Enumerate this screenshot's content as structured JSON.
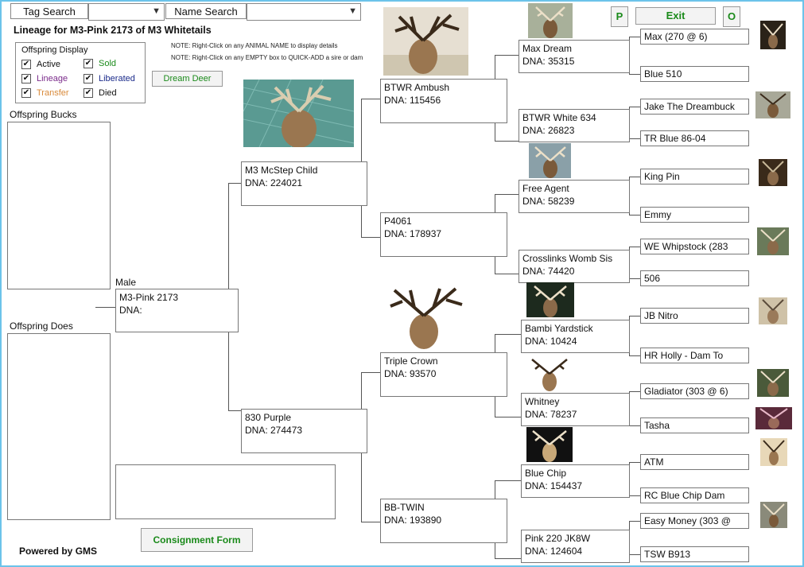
{
  "search": {
    "tag_label": "Tag Search",
    "name_label": "Name Search",
    "tag_value": "",
    "name_value": ""
  },
  "title": "Lineage for M3-Pink 2173 of M3 Whitetails",
  "notes": {
    "right_click_name": "NOTE: Right-Click on any ANIMAL NAME to display details",
    "right_click_empty": "NOTE: Right-Click on any EMPTY box to QUICK-ADD a sire or dam"
  },
  "legend": {
    "title": "Offspring Display",
    "items": [
      {
        "label": "Active",
        "checked": true,
        "color": "#111111"
      },
      {
        "label": "Sold",
        "checked": true,
        "color": "#1a8a1a"
      },
      {
        "label": "Lineage",
        "checked": true,
        "color": "#7a2a8a"
      },
      {
        "label": "Liberated",
        "checked": true,
        "color": "#1a2a8a"
      },
      {
        "label": "Transfer",
        "checked": true,
        "color": "#d98a3a"
      },
      {
        "label": "Died",
        "checked": true,
        "color": "#111111"
      }
    ]
  },
  "buttons": {
    "dream_deer": "Dream Deer",
    "p": "P",
    "exit": "Exit",
    "o": "O",
    "consignment": "Consignment Form"
  },
  "offspring": {
    "bucks_label": "Offspring Bucks",
    "does_label": "Offspring Does"
  },
  "subject": {
    "sex": "Male",
    "name": "M3-Pink 2173",
    "dna": "DNA:"
  },
  "parents": {
    "sire": {
      "name": "M3 McStep Child",
      "dna": "DNA: 224021"
    },
    "dam": {
      "name": "830 Purple",
      "dna": "DNA: 274473"
    }
  },
  "grandparents": [
    {
      "name": "BTWR Ambush",
      "dna": "DNA: 115456"
    },
    {
      "name": "P4061",
      "dna": "DNA: 178937"
    },
    {
      "name": "Triple Crown",
      "dna": "DNA: 93570"
    },
    {
      "name": "BB-TWIN",
      "dna": "DNA: 193890"
    }
  ],
  "great_grandparents": [
    {
      "name": "Max Dream",
      "dna": "DNA: 35315"
    },
    {
      "name": "BTWR White 634",
      "dna": "DNA: 26823"
    },
    {
      "name": "Free Agent",
      "dna": "DNA: 58239"
    },
    {
      "name": "Crosslinks Womb Sis",
      "dna": "DNA: 74420"
    },
    {
      "name": "Bambi Yardstick",
      "dna": "DNA: 10424"
    },
    {
      "name": "Whitney",
      "dna": "DNA: 78237"
    },
    {
      "name": "Blue Chip",
      "dna": "DNA: 154437"
    },
    {
      "name": "Pink 220 JK8W",
      "dna": "DNA: 124604"
    }
  ],
  "gen5": [
    "Max (270 @ 6)",
    "Blue 510",
    "Jake The Dreambuck",
    "TR Blue 86-04",
    "King Pin",
    "Emmy",
    "WE Whipstock (283",
    "506",
    "JB Nitro",
    "HR Holly - Dam To",
    "Gladiator (303 @ 6)",
    "Tasha",
    "ATM",
    "RC Blue Chip Dam",
    "Easy Money (303 @",
    "TSW B913"
  ],
  "footer": "Powered by GMS",
  "colors": {
    "frame": "#6cc3ea",
    "accent_green": "#1a8a1a"
  }
}
